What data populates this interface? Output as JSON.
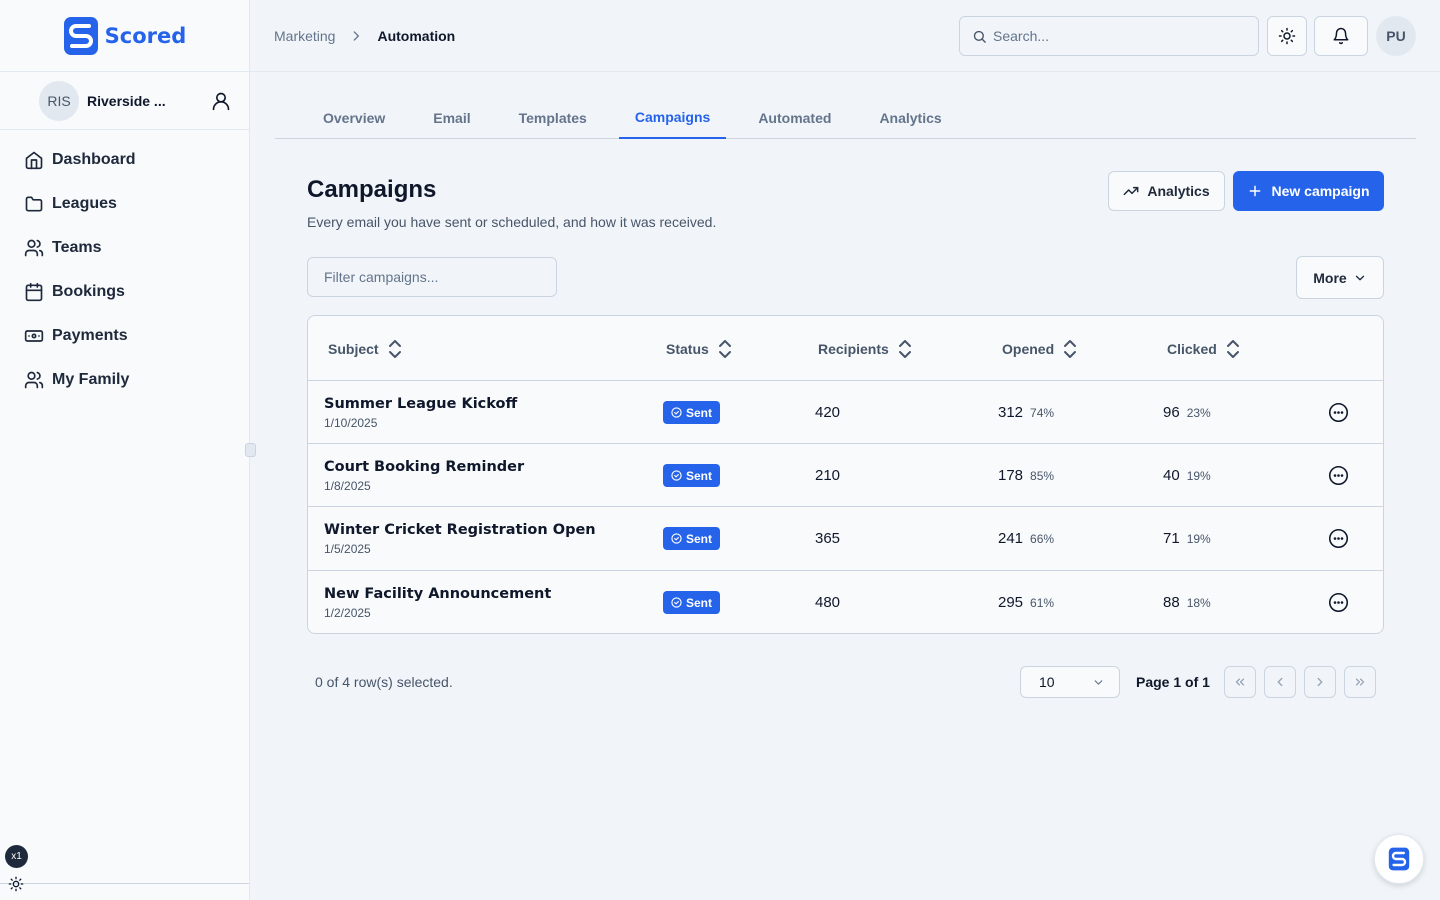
{
  "app": {
    "name": "Scored"
  },
  "org": {
    "initials": "RIS",
    "name": "Riverside ..."
  },
  "nav": [
    {
      "label": "Dashboard",
      "icon": "home-icon"
    },
    {
      "label": "Leagues",
      "icon": "folder-icon"
    },
    {
      "label": "Teams",
      "icon": "users-icon"
    },
    {
      "label": "Bookings",
      "icon": "calendar-icon"
    },
    {
      "label": "Payments",
      "icon": "banknote-icon"
    },
    {
      "label": "My Family",
      "icon": "users-icon"
    }
  ],
  "sidebar_footer": {
    "zoom_badge": "x1"
  },
  "breadcrumb": {
    "parent": "Marketing",
    "current": "Automation"
  },
  "search": {
    "placeholder": "Search..."
  },
  "user": {
    "initials": "PU"
  },
  "tabs": [
    {
      "label": "Overview",
      "active": false
    },
    {
      "label": "Email",
      "active": false
    },
    {
      "label": "Templates",
      "active": false
    },
    {
      "label": "Campaigns",
      "active": true
    },
    {
      "label": "Automated",
      "active": false
    },
    {
      "label": "Analytics",
      "active": false
    }
  ],
  "page": {
    "title": "Campaigns",
    "subtitle": "Every email you have sent or scheduled, and how it was received.",
    "analytics_button": "Analytics",
    "new_button": "New campaign",
    "filter_placeholder": "Filter campaigns...",
    "more_button": "More"
  },
  "table": {
    "headers": [
      "Subject",
      "Status",
      "Recipients",
      "Opened",
      "Clicked"
    ],
    "rows": [
      {
        "subject": "Summer League Kickoff",
        "date": "1/10/2025",
        "status": "Sent",
        "recipients": "420",
        "opened": "312",
        "opened_pct": "74%",
        "clicked": "96",
        "clicked_pct": "23%"
      },
      {
        "subject": "Court Booking Reminder",
        "date": "1/8/2025",
        "status": "Sent",
        "recipients": "210",
        "opened": "178",
        "opened_pct": "85%",
        "clicked": "40",
        "clicked_pct": "19%"
      },
      {
        "subject": "Winter Cricket Registration Open",
        "date": "1/5/2025",
        "status": "Sent",
        "recipients": "365",
        "opened": "241",
        "opened_pct": "66%",
        "clicked": "71",
        "clicked_pct": "19%"
      },
      {
        "subject": "New Facility Announcement",
        "date": "1/2/2025",
        "status": "Sent",
        "recipients": "480",
        "opened": "295",
        "opened_pct": "61%",
        "clicked": "88",
        "clicked_pct": "18%"
      }
    ]
  },
  "pagination": {
    "selection_text": "0 of 4 row(s) selected.",
    "page_size": "10",
    "page_info": "Page 1 of 1"
  },
  "colors": {
    "accent": "#2563eb",
    "background": "#f1f5f9",
    "sidebar": "#f8fafc",
    "border": "#cbd5e1"
  }
}
